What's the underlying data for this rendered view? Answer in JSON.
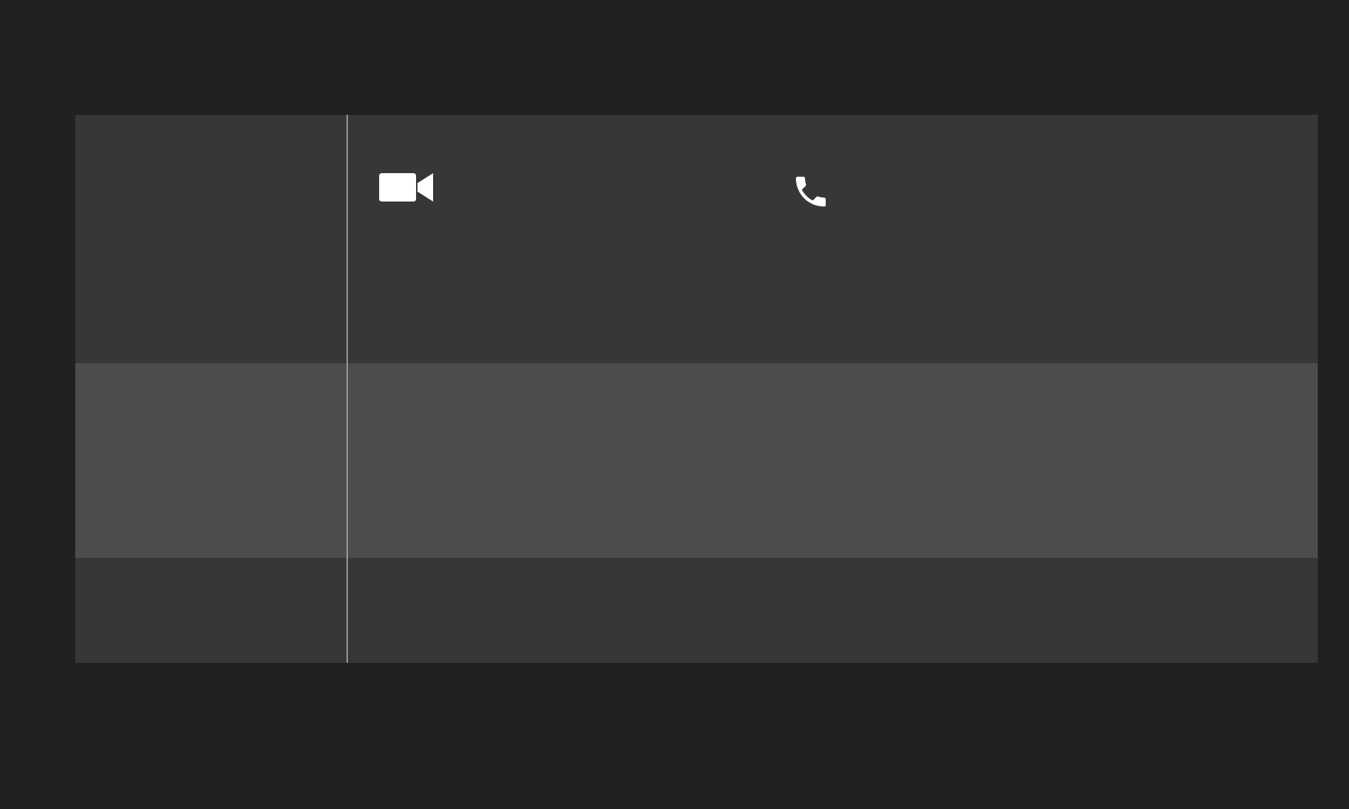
{
  "rows": [
    {
      "selected": false,
      "actions": [
        {
          "kind": "video"
        },
        {
          "kind": "phone"
        }
      ]
    },
    {
      "selected": true,
      "actions": []
    },
    {
      "selected": false,
      "actions": []
    }
  ]
}
